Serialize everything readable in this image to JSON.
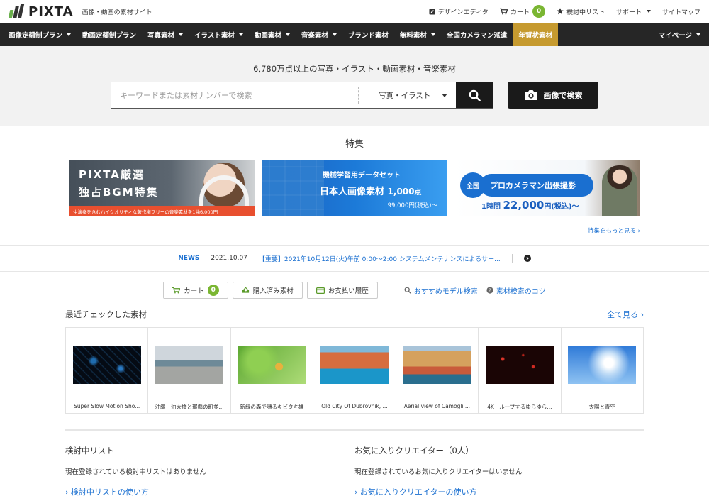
{
  "header": {
    "logo": "PIXTA",
    "tagline": "画像・動画の素材サイト",
    "links": {
      "design_editor": "デザインエディタ",
      "cart": "カート",
      "cart_count": "0",
      "wishlist": "検討中リスト",
      "support": "サポート",
      "sitemap": "サイトマップ"
    }
  },
  "nav": {
    "items": [
      {
        "label": "画像定額制プラン",
        "dropdown": true
      },
      {
        "label": "動画定額制プラン",
        "dropdown": false
      },
      {
        "label": "写真素材",
        "dropdown": true
      },
      {
        "label": "イラスト素材",
        "dropdown": true
      },
      {
        "label": "動画素材",
        "dropdown": true
      },
      {
        "label": "音楽素材",
        "dropdown": true
      },
      {
        "label": "ブランド素材",
        "dropdown": false
      },
      {
        "label": "無料素材",
        "dropdown": true
      },
      {
        "label": "全国カメラマン派遣",
        "dropdown": false
      },
      {
        "label": "年賀状素材",
        "dropdown": false
      }
    ],
    "mypage": "マイページ",
    "highlight_color": "#c69a2f"
  },
  "search": {
    "headline": "6,780万点以上の写真・イラスト・動画素材・音楽素材",
    "placeholder": "キーワードまたは素材ナンバーで検索",
    "value": "",
    "category": "写真・イラスト",
    "image_search_label": "画像で検索"
  },
  "feature": {
    "title": "特集",
    "banner1": {
      "line1": "PIXTA厳選",
      "line2": "独占BGM特集",
      "strip": "生演奏を含むハイクオリティな著作権フリーの音楽素材を1曲6,000円"
    },
    "banner2": {
      "line1": "機械学習用データセット",
      "line2": "日本人画像素材",
      "line2_count": "1,000",
      "line2_unit": "点",
      "line3": "99,000円(税込)～"
    },
    "banner3": {
      "circle": "全国",
      "pill": "プロカメラマン出張撮影",
      "price_prefix": "1時間",
      "price": "22,000",
      "price_suffix": "円(税込)～"
    },
    "more_link": "特集をもっと見る ›"
  },
  "news": {
    "label": "NEWS",
    "date": "2021.10.07",
    "text": "【重要】2021年10月12日(火)午前 0:00～2:00 システムメンテナンスによるサー..."
  },
  "quick_buttons": {
    "cart": "カート",
    "cart_count": "0",
    "purchased": "購入済み素材",
    "payment_history": "お支払い履歴",
    "recommended_model_search": "おすすめモデル検索",
    "search_tips": "素材検索のコツ"
  },
  "recent": {
    "title": "最近チェックした素材",
    "see_all": "全て見る ›",
    "items": [
      {
        "caption": "Super Slow Motion Sho..."
      },
      {
        "caption": "沖縄　泊大橋と那覇の町並..."
      },
      {
        "caption": "新緑の森で囀るキビタキ雄"
      },
      {
        "caption": "Old City Of Dubrovnik, ..."
      },
      {
        "caption": "Aerial view of Camogli ..."
      },
      {
        "caption": "4K　ループするゆらゆら..."
      },
      {
        "caption": "太陽と青空"
      }
    ]
  },
  "wishlist_section": {
    "title": "検討中リスト",
    "text": "現在登録されている検討中リストはありません",
    "link": "› 検討中リストの使い方"
  },
  "favorites_section": {
    "title": "お気に入りクリエイター（0人）",
    "text": "現在登録されているお気に入りクリエイターはいません",
    "link": "› お気に入りクリエイターの使い方"
  }
}
